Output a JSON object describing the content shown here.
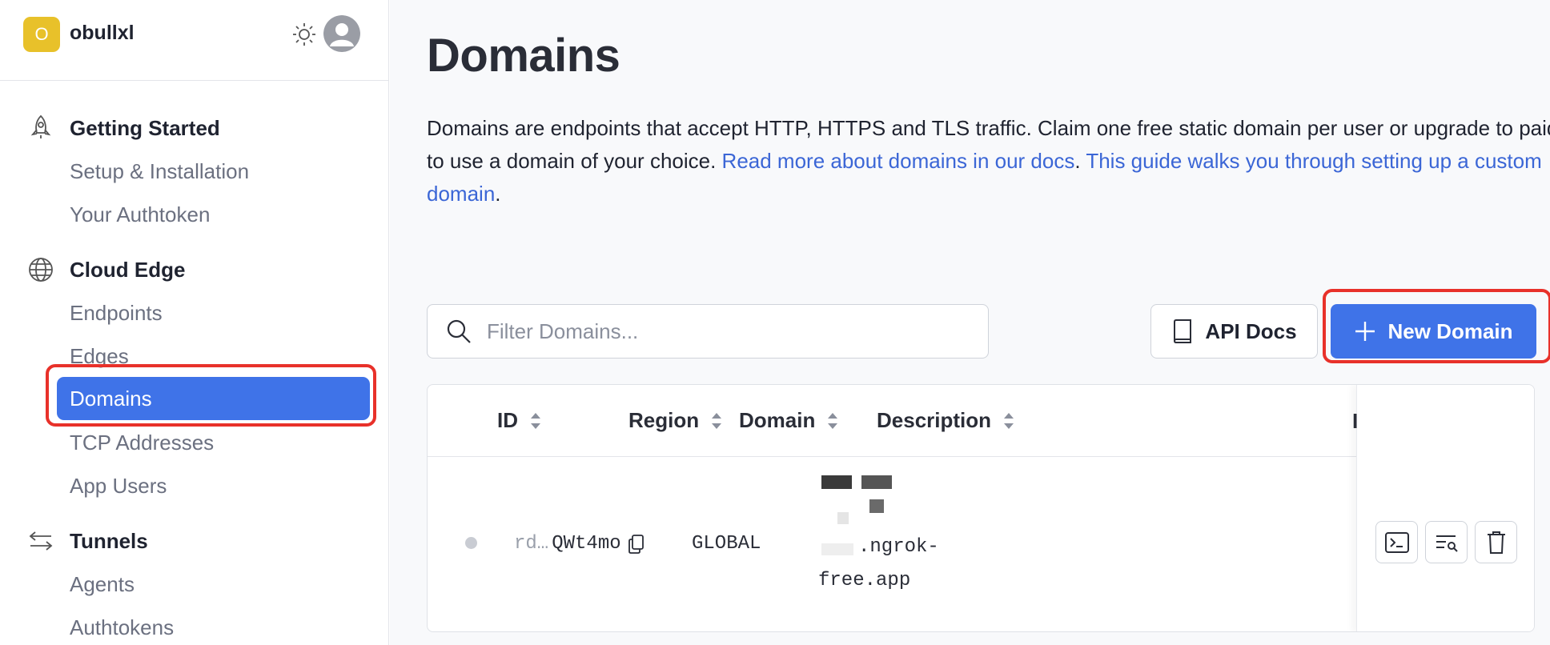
{
  "org": {
    "logo_letter": "O",
    "name": "obullxl"
  },
  "sidebar": {
    "sections": [
      {
        "title": "Getting Started",
        "items": [
          "Setup & Installation",
          "Your Authtoken"
        ]
      },
      {
        "title": "Cloud Edge",
        "items": [
          "Endpoints",
          "Edges",
          "Domains",
          "TCP Addresses",
          "App Users"
        ]
      },
      {
        "title": "Tunnels",
        "items": [
          "Agents",
          "Authtokens"
        ]
      }
    ],
    "active_item": "Domains"
  },
  "page": {
    "title": "Domains",
    "description_text": "Domains are endpoints that accept HTTP, HTTPS and TLS traffic. Claim one free static domain per user or upgrade to paid to use a domain of your choice. ",
    "link_docs": "Read more about domains in our docs",
    "sep": ". ",
    "link_guide": "This guide walks you through setting up a custom domain",
    "end": "."
  },
  "toolbar": {
    "search_placeholder": "Filter Domains...",
    "api_docs_label": "API Docs",
    "new_domain_label": "New Domain"
  },
  "table": {
    "columns": [
      "ID",
      "Region",
      "Domain",
      "Description",
      "I"
    ],
    "rows": [
      {
        "id_prefix": "rd…",
        "id_suffix": "QWt4mo",
        "region": "GLOBAL",
        "domain_line1": ".ngrok-",
        "domain_line2": "free.app",
        "description": ""
      }
    ]
  },
  "colors": {
    "accent": "#3f73e8",
    "highlight": "#e8312a",
    "logo": "#e8c12a"
  }
}
